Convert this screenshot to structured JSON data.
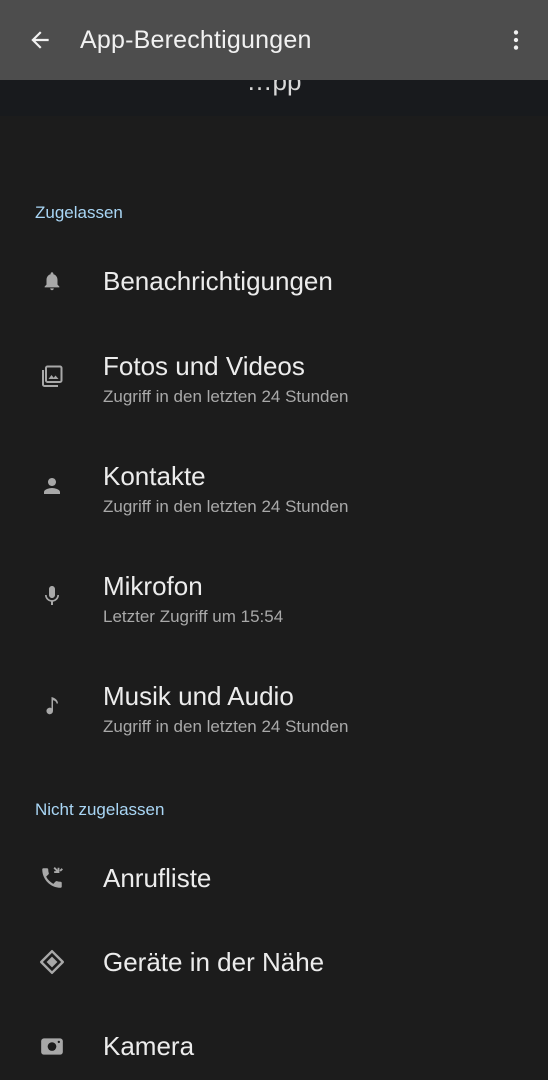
{
  "appbar": {
    "title": "App-Berechtigungen",
    "back_icon": "arrow-left-icon",
    "more_icon": "more-vert-icon"
  },
  "header_peek": "…pp",
  "sections": {
    "allowed": "Zugelassen",
    "not_allowed": "Nicht zugelassen"
  },
  "allowed_items": [
    {
      "label": "Benachrichtigungen",
      "sub": "",
      "icon": "bell-icon"
    },
    {
      "label": "Fotos und Videos",
      "sub": "Zugriff in den letzten 24 Stunden",
      "icon": "photos-icon"
    },
    {
      "label": "Kontakte",
      "sub": "Zugriff in den letzten 24 Stunden",
      "icon": "person-icon"
    },
    {
      "label": "Mikrofon",
      "sub": "Letzter Zugriff um 15:54",
      "icon": "microphone-icon"
    },
    {
      "label": "Musik und Audio",
      "sub": "Zugriff in den letzten 24 Stunden",
      "icon": "music-note-icon"
    }
  ],
  "not_allowed_items": [
    {
      "label": "Anrufliste",
      "icon": "call-log-icon"
    },
    {
      "label": "Geräte in der Nähe",
      "icon": "nearby-devices-icon"
    },
    {
      "label": "Kamera",
      "icon": "camera-icon"
    }
  ],
  "colors": {
    "background": "#1c1c1c",
    "appbar": "#4d4d4d",
    "section_header": "#a9d6f5",
    "primary_text": "#ececec",
    "secondary_text": "#a9a9a9",
    "icon": "#a8a8a8"
  }
}
